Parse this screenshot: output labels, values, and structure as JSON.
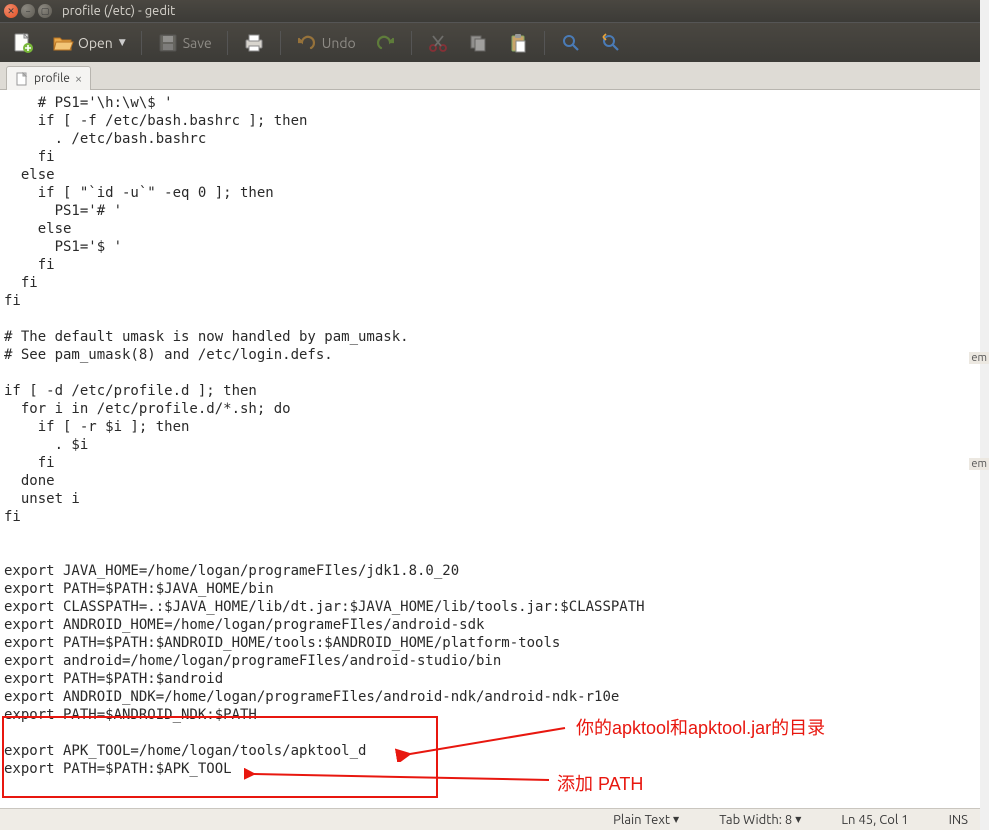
{
  "window": {
    "title": "profile (/etc) - gedit"
  },
  "toolbar": {
    "open_label": "Open",
    "save_label": "Save",
    "undo_label": "Undo"
  },
  "tab": {
    "name": "profile"
  },
  "editor": {
    "content": "    # PS1='\\h:\\w\\$ '\n    if [ -f /etc/bash.bashrc ]; then\n      . /etc/bash.bashrc\n    fi\n  else\n    if [ \"`id -u`\" -eq 0 ]; then\n      PS1='# '\n    else\n      PS1='$ '\n    fi\n  fi\nfi\n\n# The default umask is now handled by pam_umask.\n# See pam_umask(8) and /etc/login.defs.\n\nif [ -d /etc/profile.d ]; then\n  for i in /etc/profile.d/*.sh; do\n    if [ -r $i ]; then\n      . $i\n    fi\n  done\n  unset i\nfi\n\n\nexport JAVA_HOME=/home/logan/programeFIles/jdk1.8.0_20\nexport PATH=$PATH:$JAVA_HOME/bin\nexport CLASSPATH=.:$JAVA_HOME/lib/dt.jar:$JAVA_HOME/lib/tools.jar:$CLASSPATH\nexport ANDROID_HOME=/home/logan/programeFIles/android-sdk\nexport PATH=$PATH:$ANDROID_HOME/tools:$ANDROID_HOME/platform-tools\nexport android=/home/logan/programeFIles/android-studio/bin\nexport PATH=$PATH:$android\nexport ANDROID_NDK=/home/logan/programeFIles/android-ndk/android-ndk-r10e\nexport PATH=$ANDROID_NDK:$PATH\n\nexport APK_TOOL=/home/logan/tools/apktool_d\nexport PATH=$PATH:$APK_TOOL"
  },
  "statusbar": {
    "syntax": "Plain Text",
    "tabwidth": "Tab Width: 8",
    "position": "Ln 45, Col 1",
    "insert_mode": "INS"
  },
  "annotations": {
    "text1": "你的apktool和apktool.jar的目录",
    "text2": "添加 PATH"
  },
  "peek": {
    "p1": "em",
    "p2": "em"
  }
}
